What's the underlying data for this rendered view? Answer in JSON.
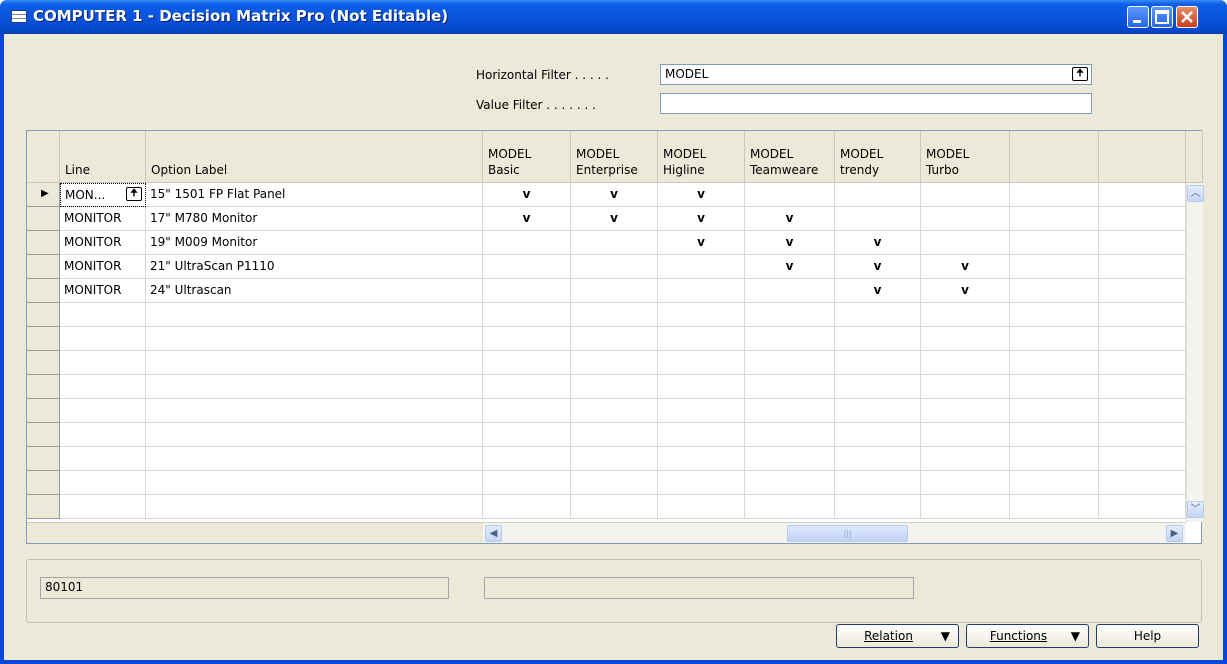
{
  "window": {
    "title": "COMPUTER 1 - Decision Matrix Pro (Not Editable)",
    "min_icon": "minimize-icon",
    "max_icon": "maximize-icon",
    "close_icon": "close-icon"
  },
  "filters": {
    "horizontal_label": "Horizontal Filter . . . . .",
    "horizontal_value": "MODEL",
    "value_label": "Value Filter . . . . . . .",
    "value_value": ""
  },
  "grid": {
    "headers": {
      "line": "Line",
      "option": "Option Label",
      "models": [
        "MODEL\nBasic",
        "MODEL\nEnterprise",
        "MODEL\nHigline",
        "MODEL\nTeamweare",
        "MODEL\ntrendy",
        "MODEL\nTurbo",
        "",
        ""
      ]
    },
    "check_mark": "v",
    "rows": [
      {
        "line": "MON...",
        "option": "15\" 1501 FP Flat Panel",
        "checks": [
          true,
          true,
          true,
          false,
          false,
          false,
          false,
          false
        ]
      },
      {
        "line": "MONITOR",
        "option": "17\" M780 Monitor",
        "checks": [
          true,
          true,
          true,
          true,
          false,
          false,
          false,
          false
        ]
      },
      {
        "line": "MONITOR",
        "option": "19\" M009 Monitor",
        "checks": [
          false,
          false,
          true,
          true,
          true,
          false,
          false,
          false
        ]
      },
      {
        "line": "MONITOR",
        "option": "21\" UltraScan P1110",
        "checks": [
          false,
          false,
          false,
          true,
          true,
          true,
          false,
          false
        ]
      },
      {
        "line": "MONITOR",
        "option": "24\" Ultrascan",
        "checks": [
          false,
          false,
          false,
          false,
          true,
          true,
          false,
          false
        ]
      }
    ],
    "empty_rows": 9
  },
  "status": {
    "left": "80101",
    "right": ""
  },
  "buttons": {
    "relation": "Relation",
    "functions": "Functions",
    "help": "Help"
  }
}
